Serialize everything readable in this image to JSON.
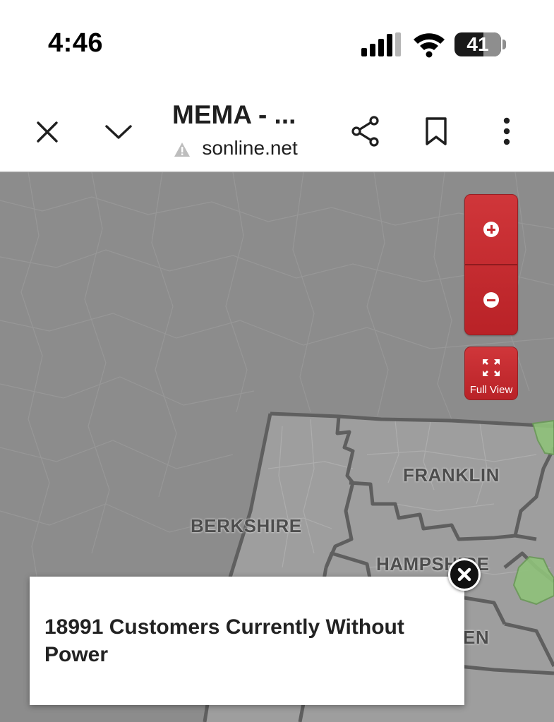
{
  "status_bar": {
    "time": "4:46",
    "battery_percent": "41"
  },
  "browser": {
    "title": "MEMA - ...",
    "url_hidden_prefix": " ",
    "url": "sonline.net",
    "icons": {
      "close": "close-icon",
      "collapse": "chevron-down-icon",
      "share": "share-icon",
      "bookmark": "bookmark-icon",
      "more": "more-vert-icon",
      "warning": "warning-icon"
    }
  },
  "map": {
    "controls": {
      "zoom_in": "zoom-in-icon",
      "zoom_out": "zoom-out-icon",
      "full_view_label": "Full View"
    },
    "counties": [
      {
        "name": "FRANKLIN"
      },
      {
        "name": "BERKSHIRE"
      },
      {
        "name": "HAMPSHIRE"
      },
      {
        "name": "EN"
      }
    ],
    "colors": {
      "map_background": "#8c8c8c",
      "county_fill": "#9e9e9e",
      "outage_fill": "#8fc27a",
      "control_red": "#c4272c"
    }
  },
  "popup": {
    "message": "18991 Customers Currently Without Power"
  }
}
